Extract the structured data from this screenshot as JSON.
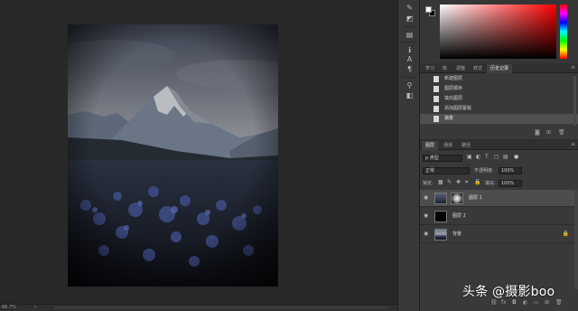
{
  "status": {
    "zoom_info": "66.7%",
    "arrow": "›"
  },
  "tools": [
    {
      "icon": "eyedropper-icon",
      "glyph": "✎"
    },
    {
      "icon": "color-swatch-icon",
      "glyph": "◩"
    },
    {
      "icon": "brush-preset-icon",
      "glyph": "▤"
    },
    {
      "icon": "info-icon",
      "glyph": "ℹ"
    },
    {
      "icon": "character-icon",
      "glyph": "A"
    },
    {
      "icon": "paragraph-icon",
      "glyph": "¶"
    },
    {
      "icon": "history-brush-icon",
      "glyph": "⚲"
    },
    {
      "icon": "layer-comps-icon",
      "glyph": "◧"
    }
  ],
  "color_panel": {
    "foreground": "#ffffff",
    "background": "#000000"
  },
  "history_panel": {
    "tabs": [
      "学习",
      "库",
      "调整",
      "样式",
      "历史记录"
    ],
    "active_tab": "历史记录",
    "items": [
      "新建图层",
      "图层顺序",
      "填充图层",
      "添加图层蒙版",
      "渐变"
    ],
    "current_item": "渐变"
  },
  "layers_panel": {
    "tabs": [
      "图层",
      "通道",
      "路径"
    ],
    "active_tab": "图层",
    "filter_kind": "ρ 类型",
    "blend_mode": "正常",
    "opacity_label": "不透明度:",
    "opacity_value": "100%",
    "lock_label": "锁定:",
    "fill_label": "填充:",
    "fill_value": "100%",
    "layers": [
      {
        "name": "图层 1",
        "selected": true,
        "has_mask": true
      },
      {
        "name": "图层 2",
        "selected": false,
        "has_mask": false
      },
      {
        "name": "背景",
        "selected": false,
        "has_mask": false,
        "locked": true
      }
    ]
  },
  "watermark": "头条 @摄影boo"
}
